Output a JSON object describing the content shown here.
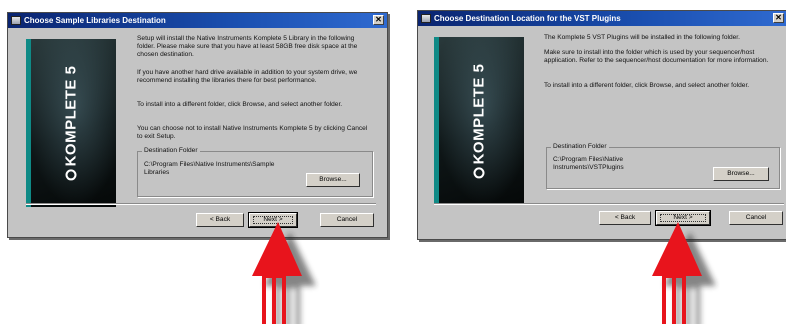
{
  "dialog_left": {
    "title": "Choose Sample Libraries Destination",
    "brand": "KOMPLETE 5",
    "paragraphs": [
      "Setup will install the Native Instruments Komplete 5 Library in the following folder. Please make sure that you have at least 58GB free disk space at the chosen destination.",
      "If you have another hard drive available in addition to your system drive, we recommend installing the libraries there for best performance.",
      "To install into a different folder, click Browse, and select another folder.",
      "You can choose not to install Native Instruments Komplete 5 by clicking Cancel to exit Setup."
    ],
    "group_label": "Destination Folder",
    "path": "C:\\Program Files\\Native Instruments\\Sample Libraries",
    "browse_label": "Browse...",
    "back_label": "< Back",
    "next_label": "Next >",
    "cancel_label": "Cancel"
  },
  "dialog_right": {
    "title": "Choose Destination Location for the VST Plugins",
    "brand": "KOMPLETE 5",
    "paragraphs": [
      "The  Komplete 5 VST Plugins will be installed in the following folder.",
      "Make sure to install into the folder which is used by your sequencer/host application. Refer to the sequencer/host documentation for more information.",
      "To install into a different folder, click Browse, and select another folder."
    ],
    "group_label": "Destination Folder",
    "path": "C:\\Program Files\\Native Instruments\\VSTPlugins",
    "browse_label": "Browse...",
    "back_label": "< Back",
    "next_label": "Next >",
    "cancel_label": "Cancel"
  },
  "colors": {
    "dialog_bg": "#c4c4c4",
    "titlebar": "#0a2470",
    "arrow": "#e8141c",
    "brand_accent": "#0f8a86"
  },
  "icons": [
    "setup-icon",
    "close-icon",
    "arrow-pointer-icon"
  ]
}
